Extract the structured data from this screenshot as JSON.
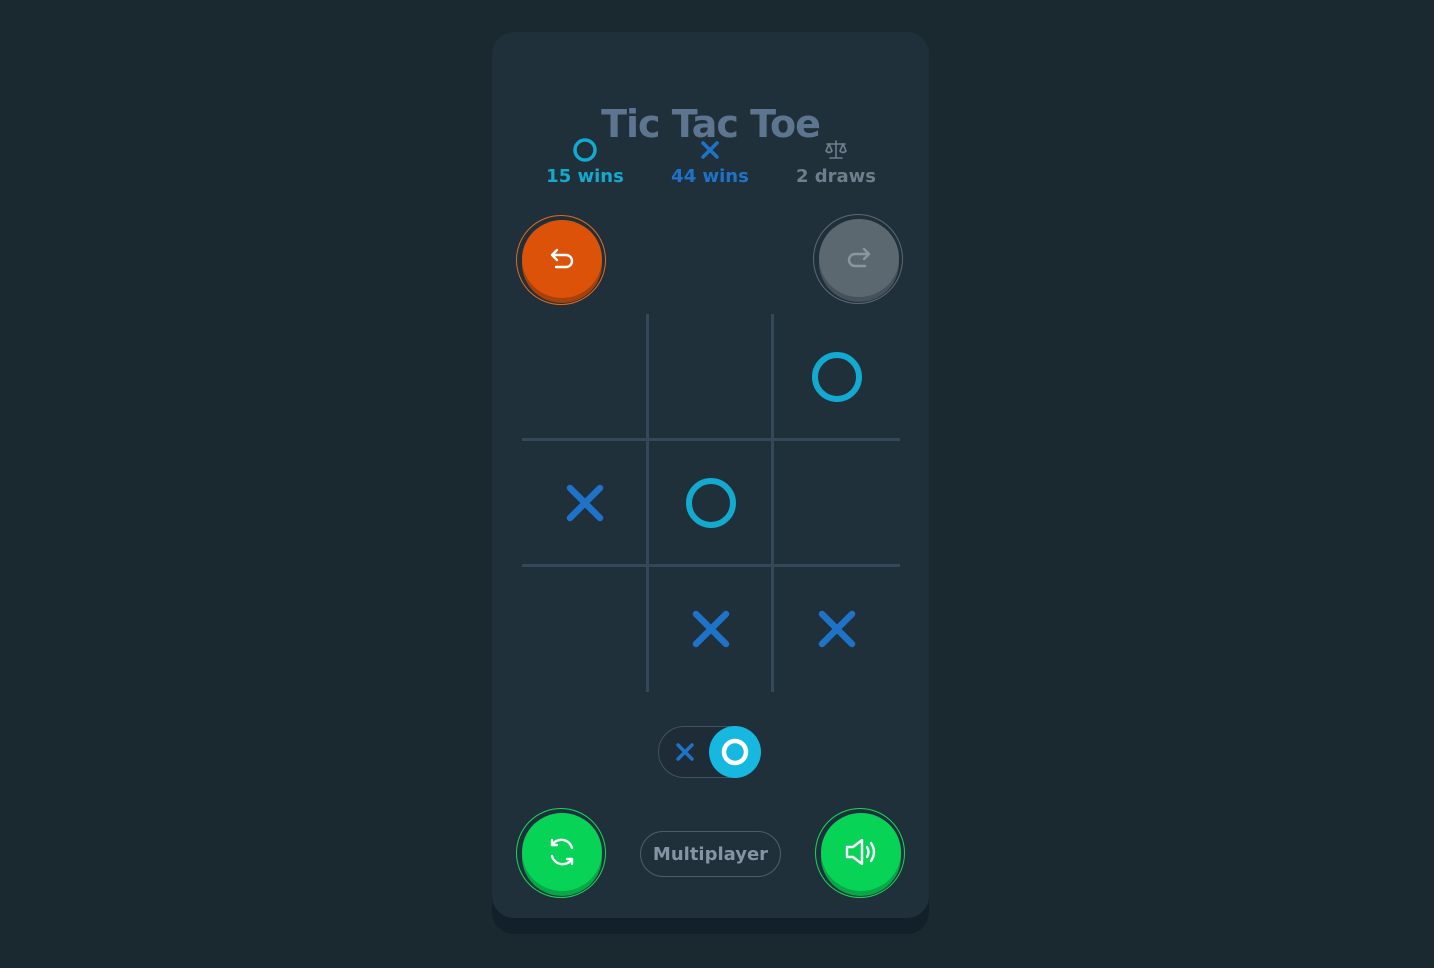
{
  "title": "Tic Tac Toe",
  "scores": {
    "o": {
      "icon": "o-mark-icon",
      "label": "15 wins"
    },
    "x": {
      "icon": "x-mark-icon",
      "label": "44 wins"
    },
    "draws": {
      "icon": "scale-icon",
      "label": "2 draws"
    }
  },
  "controls": {
    "undo_icon": "undo-arrow-icon",
    "redo_icon": "redo-arrow-icon",
    "redo_enabled": false,
    "restart_icon": "refresh-icon",
    "sound_icon": "speaker-icon",
    "mode_label": "Multiplayer"
  },
  "board": [
    "",
    "",
    "O",
    "X",
    "O",
    "",
    "",
    "X",
    "X"
  ],
  "turn_toggle": {
    "options": [
      "X",
      "O"
    ],
    "selected": "O"
  },
  "colors": {
    "o": "#14a9cf",
    "x": "#1e73c8",
    "undo": "#db5208",
    "redo_disabled": "#5c6870",
    "green": "#07d457",
    "title": "#5e7590"
  }
}
